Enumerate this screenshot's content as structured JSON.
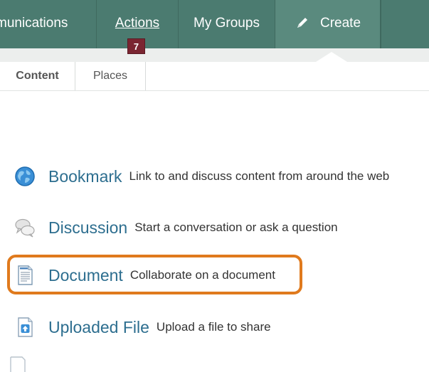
{
  "nav": {
    "communications": "munications",
    "actions": "Actions",
    "actions_badge": "7",
    "my_groups": "My Groups",
    "create": "Create"
  },
  "tabs": {
    "content": "Content",
    "places": "Places"
  },
  "create_items": [
    {
      "title": "Bookmark",
      "description": "Link to and discuss content from around the web",
      "icon": "globe-icon"
    },
    {
      "title": "Discussion",
      "description": "Start a conversation or ask a question",
      "icon": "speech-bubbles-icon"
    },
    {
      "title": "Document",
      "description": "Collaborate on a document",
      "icon": "document-icon"
    },
    {
      "title": "Uploaded File",
      "description": "Upload a file to share",
      "icon": "upload-file-icon"
    }
  ],
  "highlighted_item": "Document",
  "colors": {
    "nav_bg": "#4b7b70",
    "badge_bg": "#7a2531",
    "link": "#2d6e8f",
    "highlight": "#e07a1d"
  }
}
